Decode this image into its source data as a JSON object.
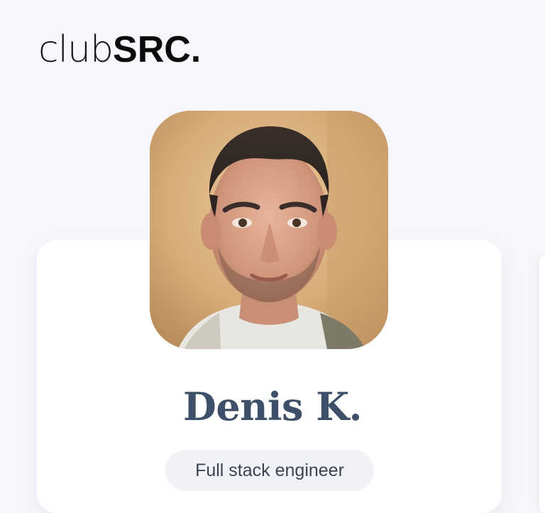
{
  "brand": {
    "logo_light": "club",
    "logo_bold": "SRC."
  },
  "profile": {
    "name": "Denis K.",
    "role": "Full stack engineer",
    "avatar_alt": "Profile photo of Denis K."
  },
  "icons": {
    "avatar": "user-photo"
  },
  "colors": {
    "background": "#f6f7fb",
    "card": "#ffffff",
    "name_text": "#3e5069",
    "badge_bg": "#f1f2f5",
    "badge_text": "#3b4453"
  }
}
